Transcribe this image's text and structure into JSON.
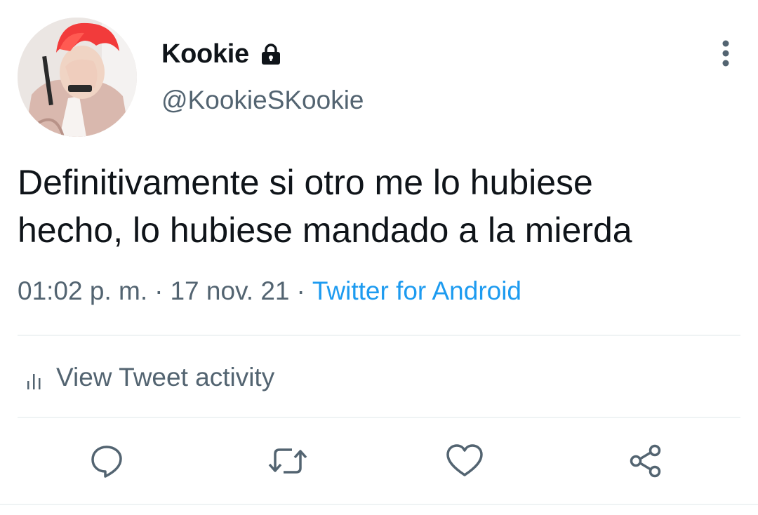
{
  "user": {
    "display_name": "Kookie",
    "handle": "@KookieSKookie",
    "protected_icon": "lock-icon",
    "avatar_icon": "profile-photo"
  },
  "tweet": {
    "text": "Definitivamente si otro me lo hubiese\nhecho, lo hubiese mandado a la mierda",
    "time": "01:02 p. m.",
    "separator": "·",
    "date": "17 nov. 21",
    "source": "Twitter for Android"
  },
  "activity": {
    "label": "View Tweet activity",
    "icon": "bar-chart-icon"
  },
  "actions": [
    {
      "name": "reply",
      "icon": "comment-icon"
    },
    {
      "name": "retweet",
      "icon": "retweet-icon"
    },
    {
      "name": "like",
      "icon": "heart-icon"
    },
    {
      "name": "share",
      "icon": "share-icon"
    }
  ],
  "menu_icon": "more-vertical-icon",
  "colors": {
    "text": "#0f1419",
    "secondary": "#536471",
    "link": "#1d9bf0",
    "divider": "#eff3f4"
  }
}
